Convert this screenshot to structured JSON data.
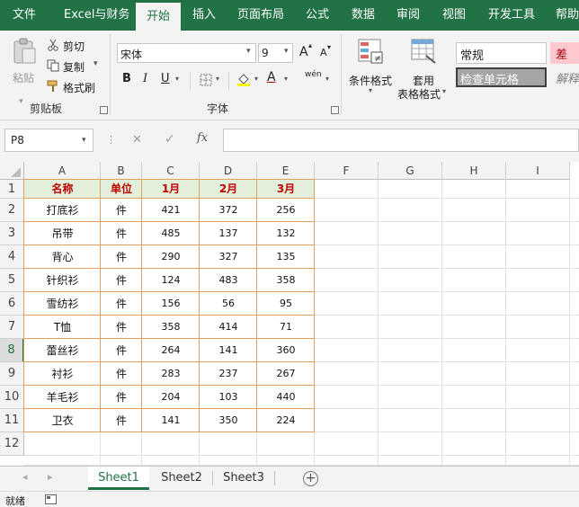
{
  "ribbon_tabs": [
    "文件",
    "Excel与财务",
    "开始",
    "插入",
    "页面布局",
    "公式",
    "数据",
    "审阅",
    "视图",
    "开发工具",
    "帮助"
  ],
  "active_tab": "开始",
  "clipboard": {
    "paste": "粘贴",
    "cut": "剪切",
    "copy": "复制",
    "format_painter": "格式刷",
    "group": "剪贴板"
  },
  "font": {
    "name": "宋体",
    "size": "9",
    "grow": "A",
    "shrink": "A",
    "bold": "B",
    "italic": "I",
    "underline": "U",
    "color_a": "A",
    "wen": "wén",
    "group": "字体"
  },
  "styles": {
    "conditional": "条件格式",
    "table_line1": "套用",
    "table_line2": "表格格式",
    "normal": "常规",
    "bad": "差",
    "check": "检查单元格",
    "explain": "解释"
  },
  "formula_bar": {
    "name_box": "P8",
    "cancel": "✕",
    "enter": "✓",
    "fx": "fx",
    "formula": ""
  },
  "columns": [
    "A",
    "B",
    "C",
    "D",
    "E",
    "F",
    "G",
    "H",
    "I"
  ],
  "rows": [
    "1",
    "2",
    "3",
    "4",
    "5",
    "6",
    "7",
    "8",
    "9",
    "10",
    "11",
    "12"
  ],
  "selected_row": "8",
  "table": {
    "headers": [
      "名称",
      "单位",
      "1月",
      "2月",
      "3月"
    ],
    "rows": [
      [
        "打底衫",
        "件",
        "421",
        "372",
        "256"
      ],
      [
        "吊带",
        "件",
        "485",
        "137",
        "132"
      ],
      [
        "背心",
        "件",
        "290",
        "327",
        "135"
      ],
      [
        "针织衫",
        "件",
        "124",
        "483",
        "358"
      ],
      [
        "雪纺衫",
        "件",
        "156",
        "56",
        "95"
      ],
      [
        "T恤",
        "件",
        "358",
        "414",
        "71"
      ],
      [
        "蕾丝衫",
        "件",
        "264",
        "141",
        "360"
      ],
      [
        "衬衫",
        "件",
        "283",
        "237",
        "267"
      ],
      [
        "羊毛衫",
        "件",
        "204",
        "103",
        "440"
      ],
      [
        "卫衣",
        "件",
        "141",
        "350",
        "224"
      ]
    ]
  },
  "sheets": [
    "Sheet1",
    "Sheet2",
    "Sheet3"
  ],
  "active_sheet": "Sheet1",
  "add_sheet": "+",
  "status": "就绪",
  "colors": {
    "accent": "#217346",
    "header_fill": "#e2efda",
    "header_text": "#c00000",
    "table_border": "#e0a060"
  }
}
